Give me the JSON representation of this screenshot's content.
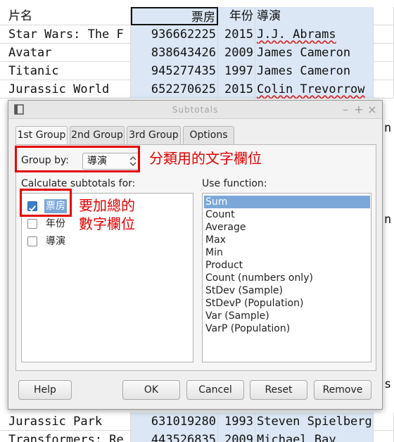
{
  "sheet": {
    "header": [
      "片名",
      "票房",
      "年份",
      "導演"
    ],
    "rows": [
      [
        "Star Wars: The F",
        "936662225",
        "2015",
        "J.J. Abrams"
      ],
      [
        "Avatar",
        "838643426",
        "2009",
        "James Cameron"
      ],
      [
        "Titanic",
        "945277435",
        "1997",
        "James Cameron"
      ],
      [
        "Jurassic World",
        "652270625",
        "2015",
        "Colin Trevorrow"
      ]
    ],
    "bottom_rows": [
      [
        "Jurassic Park",
        "631019280",
        "1993",
        "Steven Spielberg"
      ],
      [
        "Transformers: Re",
        "443526835",
        "2009",
        "Michael Bay"
      ]
    ],
    "peek_right": [
      "n",
      "n",
      "s"
    ]
  },
  "dialog": {
    "title": "Subtotals",
    "window_controls": [
      "–",
      "+",
      "×"
    ],
    "tabs": [
      "1st Group",
      "2nd Group",
      "3rd Group",
      "Options"
    ],
    "group_by_label": "Group by:",
    "group_by_value": "導演",
    "calc_label": "Calculate subtotals for:",
    "fields": [
      {
        "label": "票房",
        "checked": true
      },
      {
        "label": "年份",
        "checked": false
      },
      {
        "label": "導演",
        "checked": false
      }
    ],
    "use_function_label": "Use function:",
    "functions": [
      "Sum",
      "Count",
      "Average",
      "Max",
      "Min",
      "Product",
      "Count (numbers only)",
      "StDev (Sample)",
      "StDevP (Population)",
      "Var (Sample)",
      "VarP (Population)"
    ],
    "selected_function": "Sum",
    "buttons": {
      "help": "Help",
      "ok": "OK",
      "cancel": "Cancel",
      "reset": "Reset",
      "remove": "Remove"
    }
  },
  "annotations": {
    "group_note": "分類用的文字欄位",
    "sum_note_line1": "要加總的",
    "sum_note_line2": "數字欄位"
  },
  "colors": {
    "annotation": "#e30000",
    "selection": "#7aa7d8",
    "column_highlight": "#dbe7f5"
  }
}
